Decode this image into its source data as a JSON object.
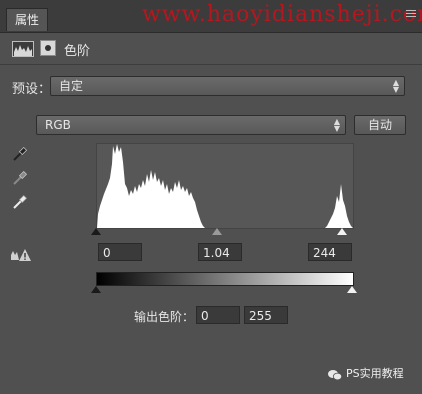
{
  "tabbar": {
    "tab_label": "属性"
  },
  "watermark": "www.haoyidiansheji.com",
  "header": {
    "title": "色阶"
  },
  "preset": {
    "label": "预设：",
    "value": "自定"
  },
  "channel": {
    "value": "RGB",
    "auto_label": "自动"
  },
  "input_levels": {
    "black": "0",
    "gamma": "1.04",
    "white": "244"
  },
  "output_levels": {
    "label": "输出色阶：",
    "black": "0",
    "white": "255"
  },
  "footer": {
    "text": "PS实用教程"
  },
  "colors": {
    "panel_bg": "#505050",
    "tab_bar_bg": "#3c3c3c",
    "field_bg": "#3a3a3a",
    "watermark": "#b31820"
  },
  "icons": [
    "levels-icon",
    "mask-icon",
    "eyedropper-black-icon",
    "eyedropper-gray-icon",
    "eyedropper-white-icon",
    "clipping-warning-icon",
    "wechat-icon",
    "panel-menu-icon"
  ]
}
